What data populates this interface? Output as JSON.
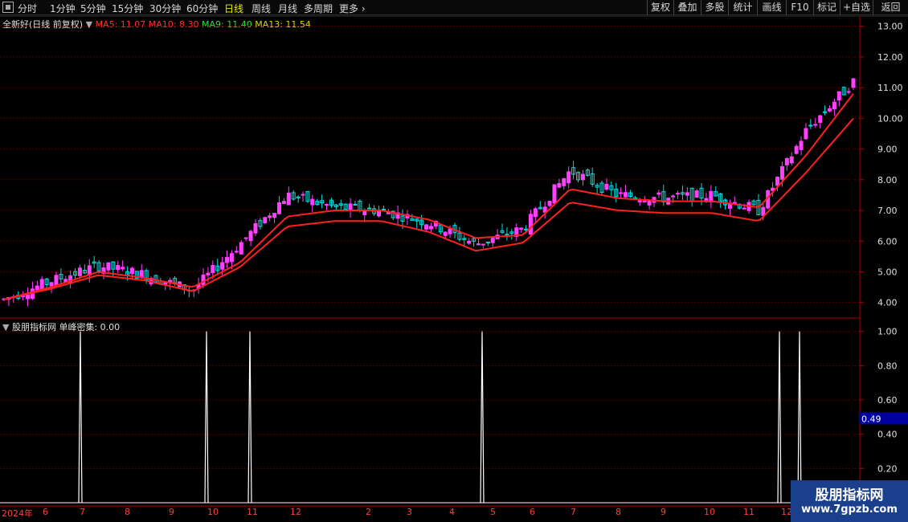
{
  "toolbar": {
    "periods": [
      "分时",
      "1分钟",
      "5分钟",
      "15分钟",
      "30分钟",
      "60分钟",
      "日线",
      "周线",
      "月线",
      "多周期",
      "更多"
    ],
    "active_period": "日线",
    "right_buttons": [
      "复权",
      "叠加",
      "多股",
      "统计",
      "画线",
      "F10",
      "标记",
      "+自选",
      "返回"
    ]
  },
  "stock": {
    "title": "全新好(日线 前复权)",
    "ma5": "MA5: 11.07",
    "ma10": "MA10: 8.30",
    "ma9": "MA9: 11.40",
    "ma13": "MA13: 11.54"
  },
  "indicator": {
    "title": "股朋指标网",
    "label": "单峰密集: 0.00",
    "cursor_value": "0.49"
  },
  "price_axis": [
    "13.00",
    "12.00",
    "11.00",
    "10.00",
    "9.00",
    "8.00",
    "7.00",
    "6.00",
    "5.00",
    "4.00"
  ],
  "indicator_axis": [
    "1.00",
    "0.80",
    "0.60",
    "0.40",
    "0.20"
  ],
  "date_axis": [
    "2024年",
    "6",
    "7",
    "8",
    "9",
    "10",
    "11",
    "12",
    "2",
    "3",
    "4",
    "5",
    "6",
    "7",
    "8",
    "9",
    "10",
    "11",
    "12"
  ],
  "colors": {
    "up": "#ff40ff",
    "down": "#00e0e0",
    "ma_short": "#ff2020",
    "ma_long": "#ff2020",
    "grid": "#6b0000",
    "spike": "#ffffff",
    "highlight": "#ffff00"
  },
  "chart_data": [
    {
      "type": "line",
      "title": "全新好(日线 前复权)",
      "xlabel": "",
      "ylabel": "",
      "ylim": [
        3.6,
        13.2
      ],
      "x": [
        "2024年",
        "6",
        "7",
        "8",
        "9",
        "10",
        "11",
        "12",
        "2",
        "3",
        "4",
        "5",
        "6",
        "7",
        "8",
        "9",
        "10",
        "11",
        "12"
      ],
      "series": [
        {
          "name": "MA5",
          "values": [
            4.1,
            4.7,
            5.2,
            4.9,
            4.4,
            5.9,
            7.5,
            7.1,
            7.0,
            6.6,
            5.9,
            6.4,
            8.3,
            7.5,
            7.4,
            7.5,
            7.0,
            9.6,
            11.2
          ]
        },
        {
          "name": "MA10",
          "values": [
            4.1,
            4.5,
            5.0,
            4.8,
            4.5,
            5.3,
            6.8,
            7.0,
            7.0,
            6.7,
            6.1,
            6.2,
            7.7,
            7.4,
            7.3,
            7.3,
            7.1,
            8.8,
            10.8
          ]
        }
      ]
    },
    {
      "type": "line",
      "title": "股朋指标网",
      "xlabel": "",
      "ylabel": "",
      "ylim": [
        0,
        1.05
      ],
      "series": [
        {
          "name": "单峰密集",
          "values": [
            0,
            1,
            0,
            1,
            1,
            0,
            1,
            0,
            1,
            1,
            0
          ]
        }
      ]
    }
  ]
}
